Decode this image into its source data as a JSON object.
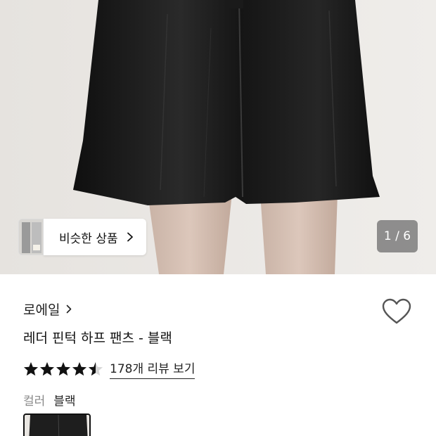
{
  "hero": {
    "similar_products_label": "비슷한 상품",
    "page_counter": "1 / 6",
    "image_alt_icon": "product-photo"
  },
  "product": {
    "brand": "로에일",
    "title": "레더 핀턱 하프 팬츠 - 블랙",
    "rating_stars": 4.5,
    "review_link": "178개 리뷰 보기",
    "option_label": "컬러",
    "option_value": "블랙"
  },
  "icons": {
    "wishlist": "heart-outline-icon",
    "chevron": "chevron-right-icon",
    "star": "star-icon"
  },
  "colors": {
    "star_fill": "#111111",
    "garment": "#1c1c1c",
    "background_wall": "#eae7e3"
  }
}
